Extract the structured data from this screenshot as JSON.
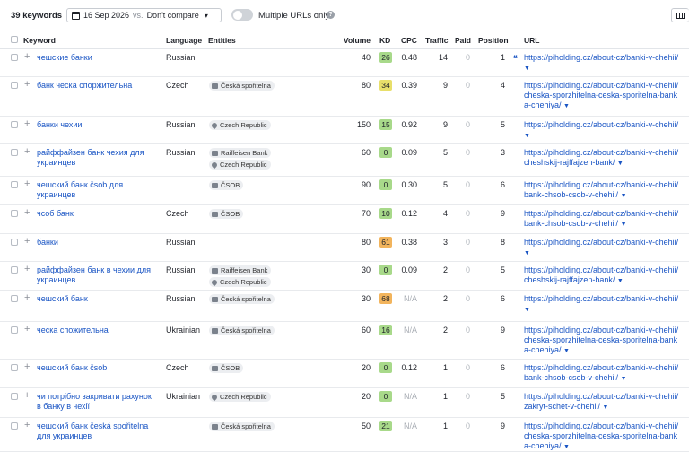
{
  "toolbar": {
    "keywords_count": "39 keywords",
    "date": "16 Sep 2026",
    "vs": "vs.",
    "compare": "Don't compare",
    "multiple_urls": "Multiple URLs only"
  },
  "columns": {
    "keyword": "Keyword",
    "language": "Language",
    "entities": "Entities",
    "volume": "Volume",
    "kd": "KD",
    "cpc": "CPC",
    "traffic": "Traffic",
    "paid": "Paid",
    "position": "Position",
    "url": "URL"
  },
  "colors": {
    "link": "#1a55c4",
    "kd_green": "#a8d98a",
    "kd_yellow": "#e8df6a",
    "kd_orange": "#f2b45c"
  },
  "rows": [
    {
      "keyword": "чешские банки",
      "language": "Russian",
      "entities": [],
      "volume": "40",
      "kd": "26",
      "cpc": "0.48",
      "traffic": "14",
      "paid": "0",
      "position": "1",
      "url": "https://piholding.cz/about-cz/banki-v-chehii/"
    },
    {
      "keyword": "банк ческа споржительна",
      "language": "Czech",
      "entities": [
        {
          "label": "Česká spořitelna",
          "icon": "building-icon"
        }
      ],
      "volume": "80",
      "kd": "34",
      "cpc": "0.39",
      "traffic": "9",
      "paid": "0",
      "position": "4",
      "url": "https://piholding.cz/about-cz/banki-v-chehii/cheska-sporzhitelna-ceska-sporitelna-banka-chehiya/"
    },
    {
      "keyword": "банки чехии",
      "language": "Russian",
      "entities": [
        {
          "label": "Czech Republic",
          "icon": "pin-icon"
        }
      ],
      "volume": "150",
      "kd": "15",
      "cpc": "0.92",
      "traffic": "9",
      "paid": "0",
      "position": "5",
      "url": "https://piholding.cz/about-cz/banki-v-chehii/"
    },
    {
      "keyword": "райффайзен банк чехия для украинцев",
      "language": "Russian",
      "entities": [
        {
          "label": "Raiffeisen Bank",
          "icon": "building-icon"
        },
        {
          "label": "Czech Republic",
          "icon": "pin-icon"
        }
      ],
      "volume": "60",
      "kd": "0",
      "cpc": "0.09",
      "traffic": "5",
      "paid": "0",
      "position": "3",
      "url": "https://piholding.cz/about-cz/banki-v-chehii/cheshskij-rajffajzen-bank/"
    },
    {
      "keyword": "чешский банк čsob для украинцев",
      "language": "",
      "entities": [
        {
          "label": "ČSOB",
          "icon": "building-icon"
        }
      ],
      "volume": "90",
      "kd": "0",
      "cpc": "0.30",
      "traffic": "5",
      "paid": "0",
      "position": "6",
      "url": "https://piholding.cz/about-cz/banki-v-chehii/bank-chsob-csob-v-chehii/"
    },
    {
      "keyword": "чсоб банк",
      "language": "Czech",
      "entities": [
        {
          "label": "ČSOB",
          "icon": "building-icon"
        }
      ],
      "volume": "70",
      "kd": "10",
      "cpc": "0.12",
      "traffic": "4",
      "paid": "0",
      "position": "9",
      "url": "https://piholding.cz/about-cz/banki-v-chehii/bank-chsob-csob-v-chehii/"
    },
    {
      "keyword": "банки",
      "language": "Russian",
      "entities": [],
      "volume": "80",
      "kd": "61",
      "cpc": "0.38",
      "traffic": "3",
      "paid": "0",
      "position": "8",
      "url": "https://piholding.cz/about-cz/banki-v-chehii/"
    },
    {
      "keyword": "райффайзен банк в чехии для украинцев",
      "language": "Russian",
      "entities": [
        {
          "label": "Raiffeisen Bank",
          "icon": "building-icon"
        },
        {
          "label": "Czech Republic",
          "icon": "pin-icon"
        }
      ],
      "volume": "30",
      "kd": "0",
      "cpc": "0.09",
      "traffic": "2",
      "paid": "0",
      "position": "5",
      "url": "https://piholding.cz/about-cz/banki-v-chehii/cheshskij-rajffajzen-bank/"
    },
    {
      "keyword": "чешский банк",
      "language": "Russian",
      "entities": [
        {
          "label": "Česká spořitelna",
          "icon": "building-icon"
        }
      ],
      "volume": "30",
      "kd": "68",
      "cpc": "N/A",
      "traffic": "2",
      "paid": "0",
      "position": "6",
      "url": "https://piholding.cz/about-cz/banki-v-chehii/"
    },
    {
      "keyword": "ческа спожительна",
      "language": "Ukrainian",
      "entities": [
        {
          "label": "Česká spořitelna",
          "icon": "building-icon"
        }
      ],
      "volume": "60",
      "kd": "16",
      "cpc": "N/A",
      "traffic": "2",
      "paid": "0",
      "position": "9",
      "url": "https://piholding.cz/about-cz/banki-v-chehii/cheska-sporzhitelna-ceska-sporitelna-banka-chehiya/"
    },
    {
      "keyword": "чешский банк čsob",
      "language": "Czech",
      "entities": [
        {
          "label": "ČSOB",
          "icon": "building-icon"
        }
      ],
      "volume": "20",
      "kd": "0",
      "cpc": "0.12",
      "traffic": "1",
      "paid": "0",
      "position": "6",
      "url": "https://piholding.cz/about-cz/banki-v-chehii/bank-chsob-csob-v-chehii/"
    },
    {
      "keyword": "чи потрібно закривати рахунок в банку в чехії",
      "language": "Ukrainian",
      "entities": [
        {
          "label": "Czech Republic",
          "icon": "pin-icon"
        }
      ],
      "volume": "20",
      "kd": "0",
      "cpc": "N/A",
      "traffic": "1",
      "paid": "0",
      "position": "5",
      "url": "https://piholding.cz/about-cz/banki-v-chehii/zakryt-schet-v-chehii/"
    },
    {
      "keyword": "чешский банк česká spořitelna для украинцев",
      "language": "",
      "entities": [
        {
          "label": "Česká spořitelna",
          "icon": "building-icon"
        }
      ],
      "volume": "50",
      "kd": "21",
      "cpc": "N/A",
      "traffic": "1",
      "paid": "0",
      "position": "9",
      "url": "https://piholding.cz/about-cz/banki-v-chehii/cheska-sporzhitelna-ceska-sporitelna-banka-chehiya/"
    }
  ]
}
